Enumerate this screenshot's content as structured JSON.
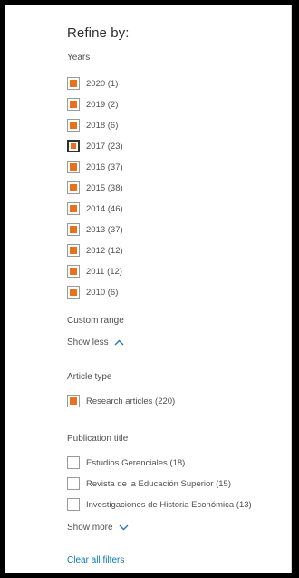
{
  "refine": {
    "title": "Refine by:",
    "years": {
      "label": "Years",
      "items": [
        {
          "label": "2020 (1)",
          "checked": true
        },
        {
          "label": "2019 (2)",
          "checked": true
        },
        {
          "label": "2018 (6)",
          "checked": true
        },
        {
          "label": "2017 (23)",
          "checked": true,
          "focused": true
        },
        {
          "label": "2016 (37)",
          "checked": true
        },
        {
          "label": "2015 (38)",
          "checked": true
        },
        {
          "label": "2014 (46)",
          "checked": true
        },
        {
          "label": "2013 (37)",
          "checked": true
        },
        {
          "label": "2012 (12)",
          "checked": true
        },
        {
          "label": "2011 (12)",
          "checked": true
        },
        {
          "label": "2010 (6)",
          "checked": true
        }
      ],
      "custom_range": "Custom range",
      "show_less": "Show less"
    },
    "article_type": {
      "label": "Article type",
      "items": [
        {
          "label": "Research articles (220)",
          "checked": true
        }
      ]
    },
    "publication_title": {
      "label": "Publication title",
      "items": [
        {
          "label": "Estudios Gerenciales (18)",
          "checked": false
        },
        {
          "label": "Revista de la Educación Superior (15)",
          "checked": false
        },
        {
          "label": "Investigaciones de Historia Económica (13)",
          "checked": false
        }
      ],
      "show_more": "Show more"
    },
    "clear_all": "Clear all filters"
  },
  "colors": {
    "accent": "#e9711c",
    "link": "#0a7bb0",
    "chevron": "#1f77c4"
  }
}
